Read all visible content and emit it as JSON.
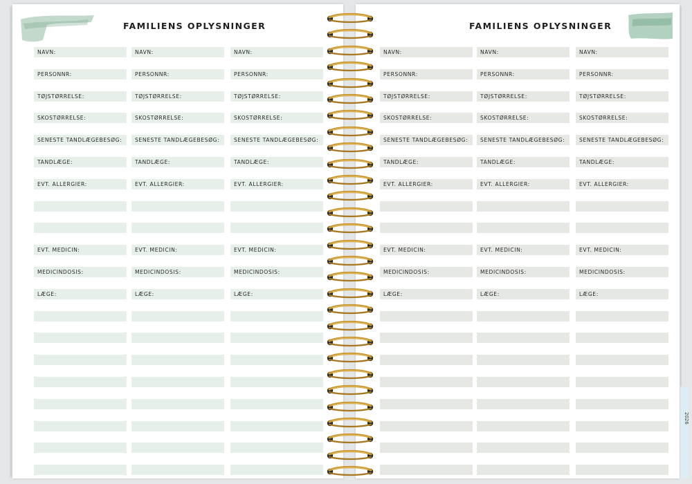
{
  "left_page": {
    "title": "FAMILIENS OPLYSNINGER",
    "columns": 3,
    "rows": [
      "NAVN:",
      "PERSONNR:",
      "TØJSTØRRELSE:",
      "SKOSTØRRELSE:",
      "SENESTE TANDLÆGEBESØG:",
      "TANDLÆGE:",
      "EVT. ALLERGIER:",
      "",
      "",
      "EVT. MEDICIN:",
      "MEDICINDOSIS:",
      "LÆGE:",
      "",
      "",
      "",
      "",
      "",
      "",
      "",
      ""
    ]
  },
  "right_page": {
    "title": "FAMILIENS OPLYSNINGER",
    "columns": 3,
    "rows": [
      "NAVN:",
      "PERSONNR:",
      "TØJSTØRRELSE:",
      "SKOSTØRRELSE:",
      "SENESTE TANDLÆGEBESØG:",
      "TANDLÆGE:",
      "EVT. ALLERGIER:",
      "",
      "",
      "EVT. MEDICIN:",
      "MEDICINDOSIS:",
      "LÆGE:",
      "",
      "",
      "",
      "",
      "",
      "",
      "",
      ""
    ]
  },
  "year_tab": "2026",
  "colors": {
    "left_bar": "#e6efe8",
    "right_bar": "#e5e8e3",
    "brush": "#8fb9a1",
    "ring_gold": "#c9972f",
    "ring_hole": "#2a2a2a",
    "tab": "#dceef4"
  }
}
